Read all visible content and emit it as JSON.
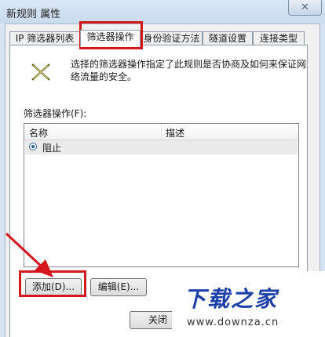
{
  "window": {
    "title": "新规则 属性",
    "close_glyph": "✕"
  },
  "tabs": [
    {
      "label": "IP 筛选器列表"
    },
    {
      "label": "筛选器操作"
    },
    {
      "label": "身份验证方法"
    },
    {
      "label": "隧道设置"
    },
    {
      "label": "连接类型"
    }
  ],
  "panel": {
    "icon": "filter-action-icon",
    "description": "选择的筛选器操作指定了此规则是否协商及如何来保证网络流量的安全。",
    "list_label": "筛选器操作(F):",
    "columns": {
      "name": "名称",
      "desc": "描述"
    },
    "rows": [
      {
        "name": "阻止",
        "desc": ""
      }
    ]
  },
  "buttons": {
    "add": "添加(D)...",
    "edit": "编辑(E)...",
    "close": "关闭"
  },
  "watermark": {
    "logo": "下载之家",
    "url": "www.downza.cn"
  },
  "colors": {
    "highlight": "#d4171f",
    "accent": "#1b3fa8"
  }
}
